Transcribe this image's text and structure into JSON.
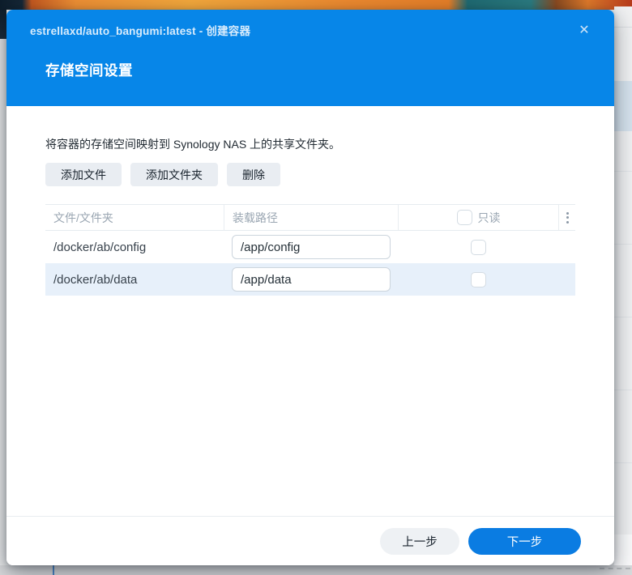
{
  "dialog": {
    "title": "estrellaxd/auto_bangumi:latest - 创建容器",
    "close_icon": "✕",
    "section_title": "存储空间设置",
    "description": "将容器的存储空间映射到 Synology NAS 上的共享文件夹。",
    "toolbar": {
      "add_file": "添加文件",
      "add_folder": "添加文件夹",
      "delete": "删除"
    },
    "table": {
      "columns": {
        "file": "文件/文件夹",
        "mount": "装载路径",
        "readonly": "只读"
      },
      "header_readonly_checked": false,
      "rows": [
        {
          "file": "/docker/ab/config",
          "mount": "/app/config",
          "readonly": false,
          "selected": false
        },
        {
          "file": "/docker/ab/data",
          "mount": "/app/data",
          "readonly": false,
          "selected": true
        }
      ]
    },
    "footer": {
      "prev": "上一步",
      "next": "下一步"
    }
  },
  "colors": {
    "header_blue": "#0786e8",
    "primary_button_blue": "#0a7ce2",
    "selected_row": "#e7f0fa",
    "toolbar_button_gray": "#e9edf2",
    "table_header_text": "#9aa6b2"
  }
}
